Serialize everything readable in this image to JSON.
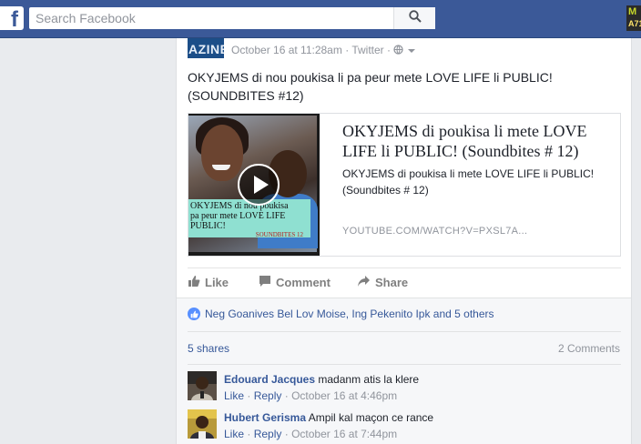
{
  "topbar": {
    "logo": "f",
    "search_placeholder": "Search Facebook",
    "badge_top": "M",
    "badge_bottom": "A71"
  },
  "post": {
    "page_avatar_text": "AZINE",
    "meta": {
      "date": "October 16 at 11:28am",
      "separator": "·",
      "source": "Twitter",
      "separator2": "·"
    },
    "text": "OKYJEMS di nou poukisa li pa peur mete LOVE LIFE li PUBLIC! (SOUNDBITES #12)",
    "preview": {
      "thumbnail_banner_line1": "OKYJEMS  di nou poukisa",
      "thumbnail_banner_line2": "pa peur mete LOVE LIFE",
      "thumbnail_banner_line3": "PUBLIC!",
      "thumbnail_banner_tag": "SOUNDBITES 12",
      "title": "OKYJEMS di poukisa li mete LOVE LIFE li PUBLIC! (Soundbites # 12)",
      "description": "OKYJEMS di poukisa li mete LOVE LIFE li PUBLIC! (Soundbites # 12)",
      "domain": "YOUTUBE.COM/WATCH?V=PXSL7A..."
    },
    "actions": {
      "like": "Like",
      "comment": "Comment",
      "share": "Share"
    },
    "likes_summary": "Neg Goanives Bel Lov Moise, Ing Pekenito Ipk and 5 others",
    "shares_count": "5 shares",
    "comments_count": "2 Comments",
    "comments": [
      {
        "author": "Edouard Jacques",
        "text": "madanm atis la klere",
        "like": "Like",
        "reply": "Reply",
        "sep": "·",
        "time": "October 16 at 4:46pm"
      },
      {
        "author": "Hubert Gerisma",
        "text": "Ampil kal maçon ce rance",
        "like": "Like",
        "reply": "Reply",
        "sep": "·",
        "time": "October 16 at 7:44pm"
      }
    ]
  },
  "colors": {
    "brand_blue": "#3b5998",
    "link_blue": "#365899",
    "meta_gray": "#90949c"
  },
  "icons": [
    "facebook-logo-icon",
    "search-icon",
    "globe-icon",
    "chevron-down-icon",
    "thumbs-up-icon",
    "comment-icon",
    "share-icon",
    "play-icon"
  ]
}
